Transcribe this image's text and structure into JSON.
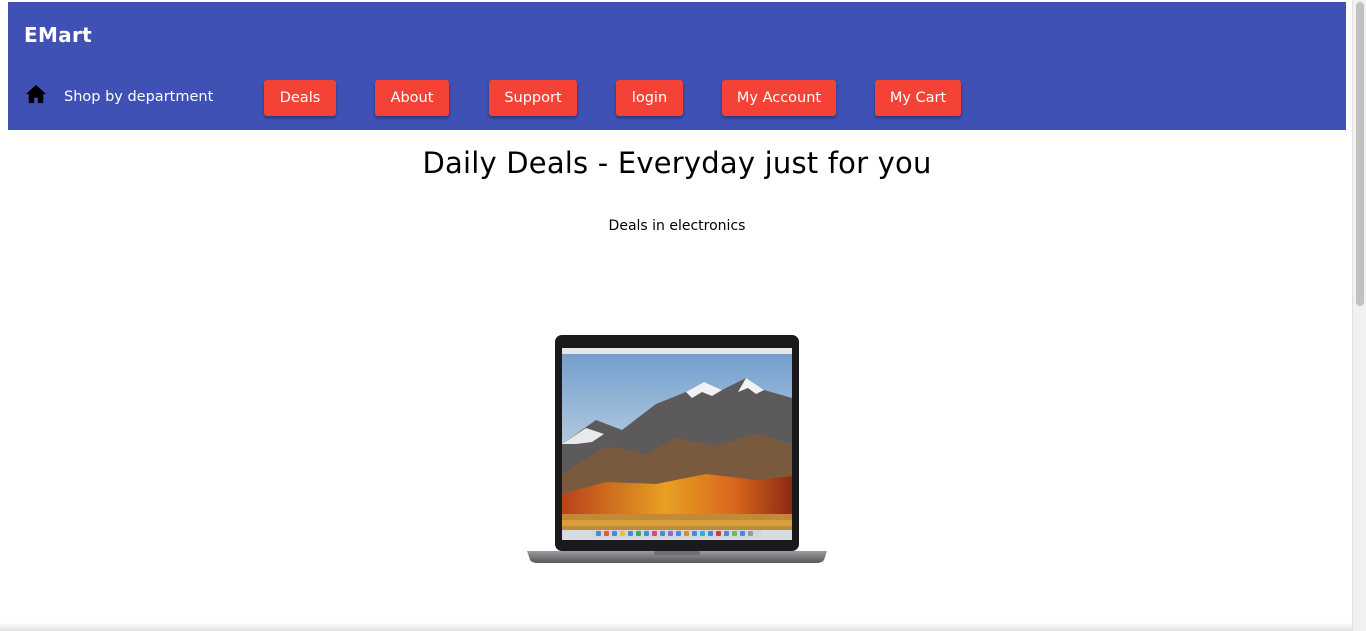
{
  "header": {
    "brand": "EMart",
    "home_icon": "home-icon",
    "shop_label": "Shop by department",
    "background": "#3f51b5",
    "nav": [
      {
        "label": "Deals"
      },
      {
        "label": "About"
      },
      {
        "label": "Support"
      },
      {
        "label": "login"
      },
      {
        "label": "My Account"
      },
      {
        "label": "My Cart"
      }
    ],
    "button_color": "#f44336"
  },
  "main": {
    "title": "Daily Deals - Everyday just for you",
    "subtitle": "Deals in electronics",
    "product_image": "laptop-image"
  }
}
